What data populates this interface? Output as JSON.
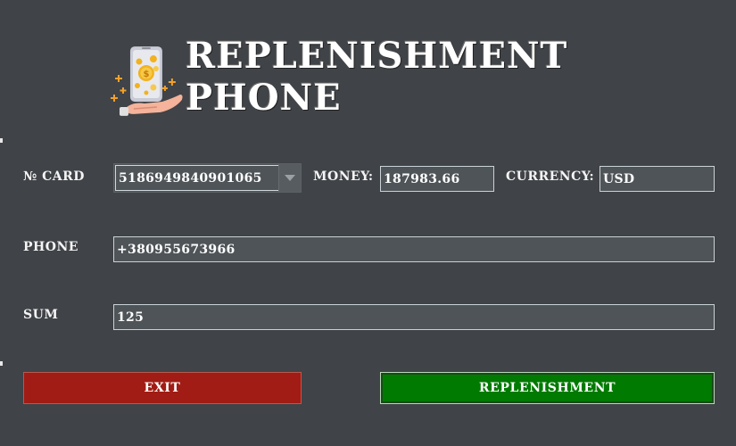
{
  "header": {
    "title": "REPLENISHMENT PHONE",
    "logo_icon": "phone-money-icon"
  },
  "form": {
    "card_label": "№ CARD",
    "card_value": "5186949840901065",
    "money_label": "MONEY:",
    "money_value": "187983.66",
    "currency_label": "CURRENCY:",
    "currency_value": "USD",
    "phone_label": "PHONE",
    "phone_value": "+380955673966",
    "sum_label": "SUM",
    "sum_value": "125"
  },
  "buttons": {
    "exit_label": "EXIT",
    "replenish_label": "REPLENISHMENT"
  },
  "colors": {
    "background": "#404347",
    "field_bg": "#4f5458",
    "exit_button": "#a01c14",
    "replenish_button": "#007a00"
  }
}
